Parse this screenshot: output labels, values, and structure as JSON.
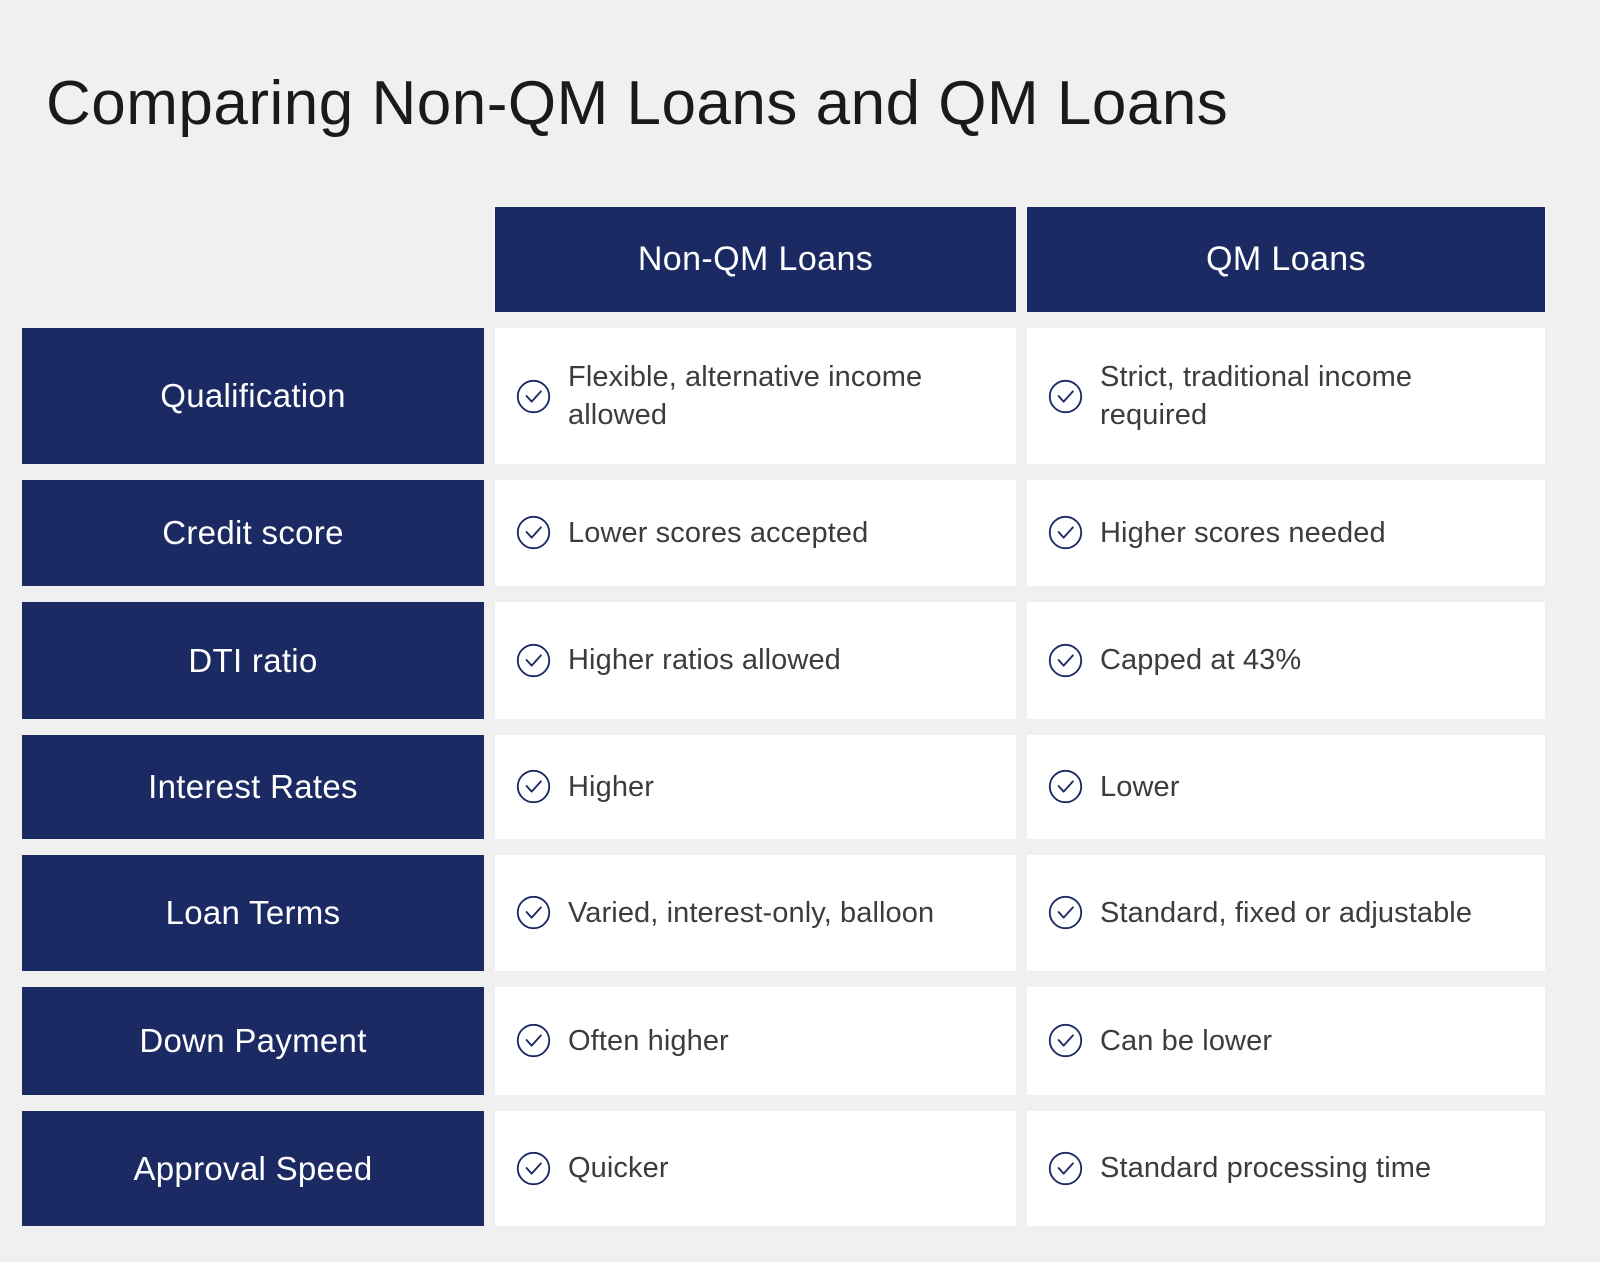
{
  "title": "Comparing Non-QM Loans and QM Loans",
  "colors": {
    "background": "#f0f0f0",
    "navy": "#1c2a63",
    "cell_background": "#ffffff",
    "body_text": "#3c3c3c",
    "title_text": "#1a1a1a",
    "header_text": "#ffffff"
  },
  "columns": [
    {
      "label": "Non-QM Loans"
    },
    {
      "label": "QM Loans"
    }
  ],
  "icons": {
    "check": "check-circle-icon"
  },
  "rows": [
    {
      "label": "Qualification",
      "non_qm": "Flexible, alternative income allowed",
      "qm": "Strict, traditional income required",
      "height_class": "r-h1"
    },
    {
      "label": "Credit score",
      "non_qm": "Lower scores accepted",
      "qm": "Higher scores needed",
      "height_class": "r-h2"
    },
    {
      "label": "DTI ratio",
      "non_qm": "Higher ratios allowed",
      "qm": "Capped at 43%",
      "height_class": "r-h3"
    },
    {
      "label": "Interest Rates",
      "non_qm": "Higher",
      "qm": "Lower",
      "height_class": "r-h4"
    },
    {
      "label": "Loan Terms",
      "non_qm": "Varied, interest-only, balloon",
      "qm": "Standard, fixed or adjustable",
      "height_class": "r-h5"
    },
    {
      "label": "Down Payment",
      "non_qm": "Often higher",
      "qm": "Can be lower",
      "height_class": "r-h6"
    },
    {
      "label": "Approval Speed",
      "non_qm": "Quicker",
      "qm": "Standard processing time",
      "height_class": "r-h7"
    }
  ]
}
